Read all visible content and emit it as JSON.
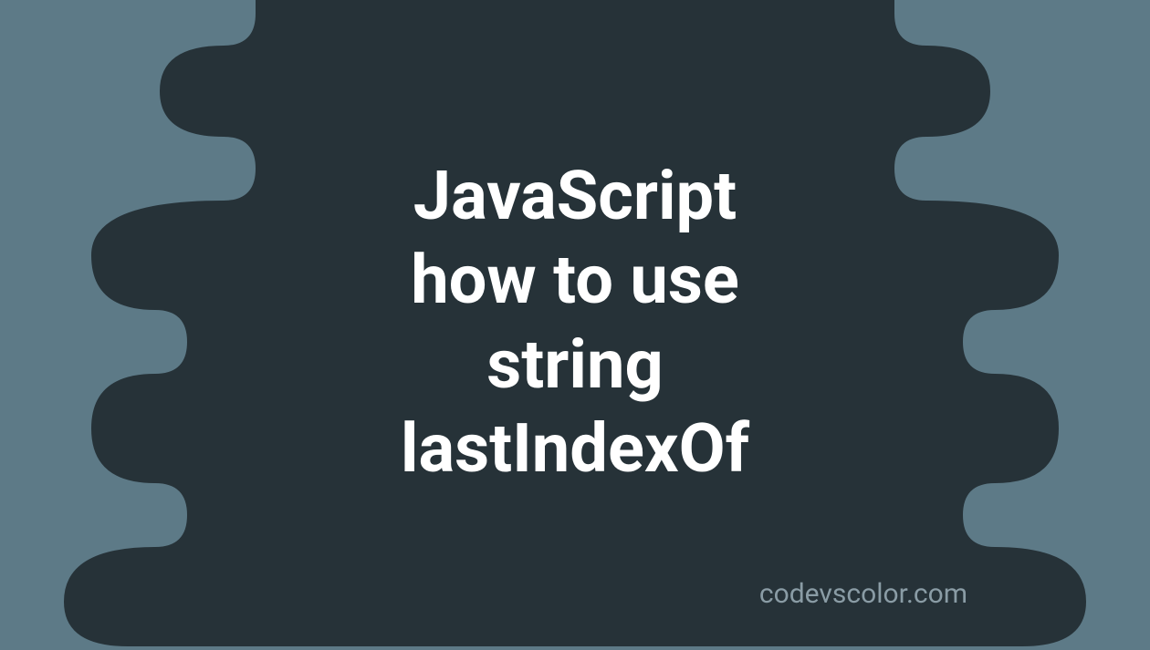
{
  "title": "JavaScript\nhow to use\nstring\nlastIndexOf",
  "watermark": "codevscolor.com",
  "colors": {
    "background": "#5d7a87",
    "blob": "#263238",
    "text": "#ffffff",
    "watermark": "#8a9ca5"
  }
}
